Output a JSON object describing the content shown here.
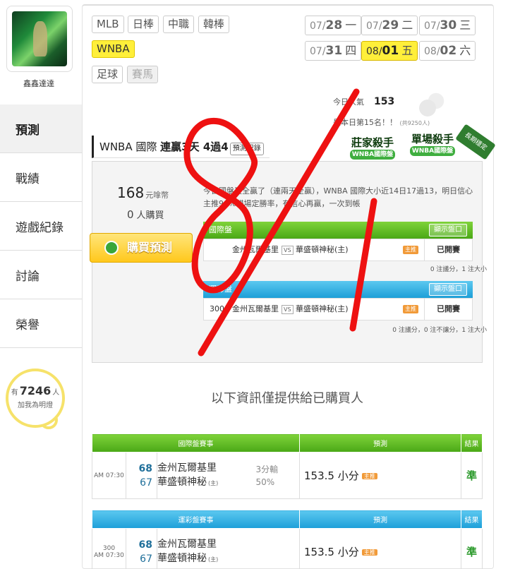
{
  "sidebar": {
    "username": "鑫鑫達達",
    "nav": [
      {
        "label": "預測",
        "active": true
      },
      {
        "label": "戰績",
        "active": false
      },
      {
        "label": "遊戲紀錄",
        "active": false
      },
      {
        "label": "討論",
        "active": false
      },
      {
        "label": "榮譽",
        "active": false
      }
    ],
    "bulb": {
      "prefix": "有",
      "count": "7246",
      "unit": "人",
      "line2": "加我為明燈"
    }
  },
  "leagues": [
    {
      "label": "MLB",
      "state": "normal"
    },
    {
      "label": "日棒",
      "state": "normal"
    },
    {
      "label": "中職",
      "state": "normal"
    },
    {
      "label": "韓棒",
      "state": "normal"
    },
    {
      "label": "WNBA",
      "state": "active"
    },
    {
      "label": "足球",
      "state": "normal"
    },
    {
      "label": "賽馬",
      "state": "dim"
    }
  ],
  "dates": [
    {
      "month": "07/",
      "day": "28",
      "weekday": "一",
      "active": false
    },
    {
      "month": "07/",
      "day": "29",
      "weekday": "二",
      "active": false
    },
    {
      "month": "07/",
      "day": "30",
      "weekday": "三",
      "active": false
    },
    {
      "month": "07/",
      "day": "31",
      "weekday": "四",
      "active": false
    },
    {
      "month": "08/",
      "day": "01",
      "weekday": "五",
      "active": true
    },
    {
      "month": "08/",
      "day": "02",
      "weekday": "六",
      "active": false
    }
  ],
  "popularity": {
    "label": "今日人氣",
    "value": "153"
  },
  "rank": {
    "text": "是本日第15名！！",
    "note": "(共9250人)"
  },
  "banner": {
    "league": "WNBA 國際",
    "streak": "連贏3天 4過4",
    "record_button": "預測紀錄"
  },
  "badges": [
    {
      "title": "莊家殺手",
      "sub": "WNBA國際盤"
    },
    {
      "title": "單場殺手",
      "sub": "WNBA國際盤"
    }
  ],
  "ribbon": "長期穩定",
  "purchase": {
    "price": "168",
    "price_unit": "元嗱幣",
    "buyers": "0",
    "buyers_unit": "人購買",
    "buy_button": "購買預測"
  },
  "description": "今日國盤又全贏了（連兩天全贏），WNBA 國際大小近14日17過13，明日信心主推99%貓場定勝率，有信心再贏，一次到帳",
  "markets": [
    {
      "name": "國際盤",
      "color": "green",
      "show_button": "顯示盤口",
      "prefix": "",
      "away": "金州瓦爾基里",
      "vs": "VS",
      "home": "華盛頓神秘(主)",
      "pick_tag": "主推",
      "status": "已開賽",
      "footer": "0 注議分，1 注大小"
    },
    {
      "name": "運彩盤",
      "color": "blue",
      "show_button": "顯示盤口",
      "prefix": "300",
      "away": "金州瓦爾基里",
      "vs": "VS",
      "home": "華盛頓神秘(主)",
      "pick_tag": "主推",
      "status": "已開賽",
      "footer": "0 注議分，0 注不讓分，1 注大小"
    }
  ],
  "info_note": "以下資訊僅提供給已購買人",
  "results": [
    {
      "header_event": "國際盤賽事",
      "header_pred": "預測",
      "header_result": "結果",
      "color": "green",
      "time_code": "",
      "time": "AM 07:30",
      "score_away": "68",
      "score_home": "67",
      "away": "金州瓦爾基里",
      "home": "華盛頓神秘",
      "home_tag": "(主)",
      "margin_line1": "3分輸",
      "margin_line2": "50%",
      "prediction": "153.5 小分",
      "pick_tag": "主推",
      "result": "準"
    },
    {
      "header_event": "運彩盤賽事",
      "header_pred": "預測",
      "header_result": "結果",
      "color": "blue",
      "time_code": "300",
      "time": "AM 07:30",
      "score_away": "68",
      "score_home": "67",
      "away": "金州瓦爾基里",
      "home": "華盛頓神秘",
      "home_tag": "(主)",
      "margin_line1": "",
      "margin_line2": "",
      "prediction": "153.5 小分",
      "pick_tag": "主推",
      "result": "準"
    }
  ],
  "handwriting": "8/1",
  "colors": {
    "accent_yellow": "#ffef3a",
    "green": "#4aa816",
    "blue": "#1d9fd8",
    "scribble_red": "#ee1111"
  }
}
